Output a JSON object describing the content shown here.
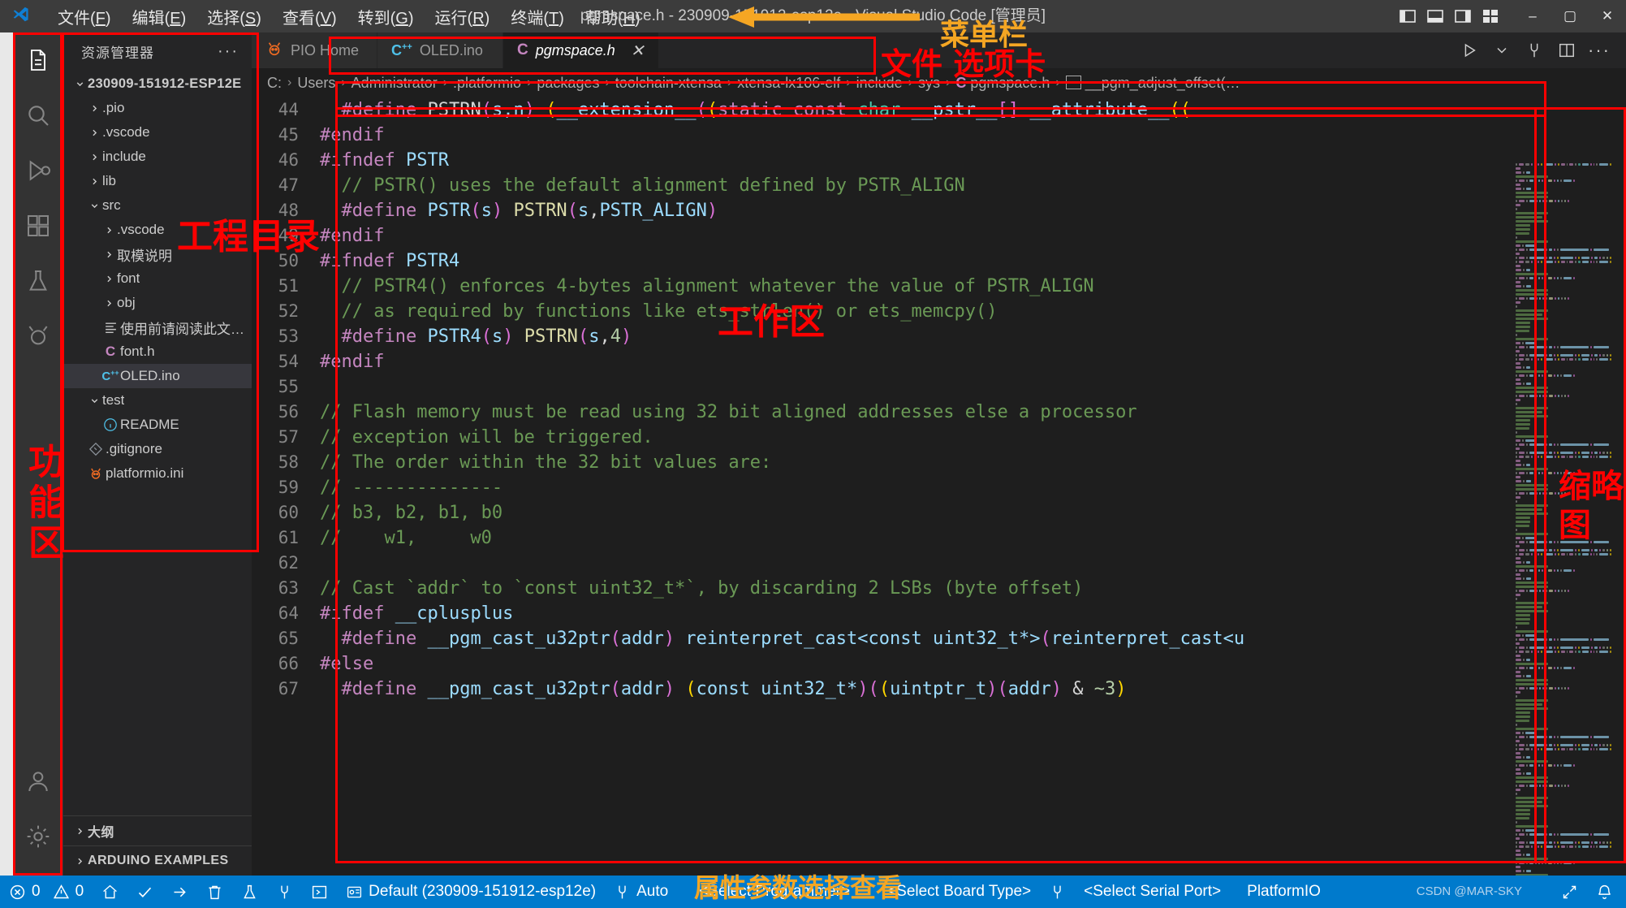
{
  "window": {
    "title": "pgmspace.h - 230909-151912-esp12e - Visual Studio Code [管理员]",
    "minimize": "–",
    "maximize": "▢",
    "close": "✕"
  },
  "menubar": {
    "items": [
      {
        "label": "文件",
        "accel": "F"
      },
      {
        "label": "编辑",
        "accel": "E"
      },
      {
        "label": "选择",
        "accel": "S"
      },
      {
        "label": "查看",
        "accel": "V"
      },
      {
        "label": "转到",
        "accel": "G"
      },
      {
        "label": "运行",
        "accel": "R"
      },
      {
        "label": "终端",
        "accel": "T"
      },
      {
        "label": "帮助",
        "accel": "H"
      }
    ]
  },
  "activitybar": {
    "items": [
      {
        "name": "explorer",
        "icon": "files-icon",
        "active": true
      },
      {
        "name": "search",
        "icon": "search-icon",
        "active": false
      },
      {
        "name": "run-debug",
        "icon": "run-debug-icon",
        "active": false
      },
      {
        "name": "extensions",
        "icon": "extensions-icon",
        "active": false
      },
      {
        "name": "testing",
        "icon": "flask-icon",
        "active": false
      },
      {
        "name": "platformio",
        "icon": "platformio-ant-icon",
        "active": false
      },
      {
        "name": "accounts",
        "icon": "account-icon",
        "active": false
      },
      {
        "name": "settings",
        "icon": "gear-icon",
        "active": false
      }
    ]
  },
  "sidebar": {
    "title": "资源管理器",
    "more": "···",
    "root": "230909-151912-ESP12E",
    "tree": [
      {
        "label": ".pio",
        "indent": 1,
        "type": "folder",
        "expanded": false
      },
      {
        "label": ".vscode",
        "indent": 1,
        "type": "folder",
        "expanded": false
      },
      {
        "label": "include",
        "indent": 1,
        "type": "folder",
        "expanded": false
      },
      {
        "label": "lib",
        "indent": 1,
        "type": "folder",
        "expanded": false
      },
      {
        "label": "src",
        "indent": 1,
        "type": "folder",
        "expanded": true
      },
      {
        "label": ".vscode",
        "indent": 2,
        "type": "folder",
        "expanded": false
      },
      {
        "label": "取模说明",
        "indent": 2,
        "type": "folder",
        "expanded": false
      },
      {
        "label": "font",
        "indent": 2,
        "type": "folder",
        "expanded": false
      },
      {
        "label": "obj",
        "indent": 2,
        "type": "folder",
        "expanded": false
      },
      {
        "label": "使用前请阅读此文档…",
        "indent": 2,
        "type": "file",
        "icon": "text-file-icon"
      },
      {
        "label": "font.h",
        "indent": 2,
        "type": "file",
        "icon": "c-header-icon"
      },
      {
        "label": "OLED.ino",
        "indent": 2,
        "type": "file",
        "icon": "cpp-file-icon",
        "selected": true
      },
      {
        "label": "test",
        "indent": 1,
        "type": "folder",
        "expanded": true
      },
      {
        "label": "README",
        "indent": 2,
        "type": "file",
        "icon": "info-icon"
      },
      {
        "label": ".gitignore",
        "indent": 1,
        "type": "file",
        "icon": "git-icon"
      },
      {
        "label": "platformio.ini",
        "indent": 1,
        "type": "file",
        "icon": "platformio-ant-icon"
      }
    ],
    "sections": [
      {
        "label": "大纲"
      },
      {
        "label": "ARDUINO EXAMPLES"
      }
    ]
  },
  "tabs": [
    {
      "label": "PIO Home",
      "icon": "platformio-ant-icon",
      "active": false,
      "closable": false
    },
    {
      "label": "OLED.ino",
      "icon": "cpp-file-icon",
      "active": false,
      "closable": false
    },
    {
      "label": "pgmspace.h",
      "icon": "c-header-icon",
      "active": true,
      "closable": true,
      "close": "✕"
    }
  ],
  "tab_actions": [
    {
      "name": "run-button",
      "icon": "play-icon"
    },
    {
      "name": "run-dropdown",
      "icon": "chevron-down-icon"
    },
    {
      "name": "serial-monitor-button",
      "icon": "plug-icon"
    },
    {
      "name": "split-editor-button",
      "icon": "split-icon"
    },
    {
      "name": "more-actions-button",
      "icon": "ellipsis-icon"
    }
  ],
  "breadcrumb": {
    "items": [
      "C:",
      "Users",
      "Administrator",
      ".platformio",
      "packages",
      "toolchain-xtensa",
      "xtensa-lx106-elf",
      "include",
      "sys",
      "pgmspace.h",
      "__pgm_adjust_offset(…"
    ],
    "separator": "›"
  },
  "code": {
    "first_line": 44,
    "lines": [
      {
        "n": 44,
        "tokens": [
          {
            "t": "  ",
            "c": "k-txt"
          },
          {
            "t": "#define",
            "c": "k-pre"
          },
          {
            "t": " PSTRN",
            "c": "k-txt"
          },
          {
            "t": "(",
            "c": "k-pr"
          },
          {
            "t": "s,n",
            "c": "k-id"
          },
          {
            "t": ")",
            "c": "k-pr"
          },
          {
            "t": " (",
            "c": "k-pl"
          },
          {
            "t": "__extension__",
            "c": "k-id"
          },
          {
            "t": "(",
            "c": "k-pr"
          },
          {
            "t": "(",
            "c": "k-pl"
          },
          {
            "t": "static",
            "c": "k-pre"
          },
          {
            "t": " ",
            "c": "k-txt"
          },
          {
            "t": "const",
            "c": "k-pre"
          },
          {
            "t": " ",
            "c": "k-txt"
          },
          {
            "t": "char",
            "c": "k-type"
          },
          {
            "t": " __pstr__",
            "c": "k-id"
          },
          {
            "t": "[",
            "c": "k-pr"
          },
          {
            "t": "]",
            "c": "k-pr"
          },
          {
            "t": " ",
            "c": "k-txt"
          },
          {
            "t": "__attribute__",
            "c": "k-id"
          },
          {
            "t": "((",
            "c": "k-pl"
          }
        ]
      },
      {
        "n": 45,
        "tokens": [
          {
            "t": "#endif",
            "c": "k-pre"
          }
        ]
      },
      {
        "n": 46,
        "tokens": [
          {
            "t": "#ifndef",
            "c": "k-pre"
          },
          {
            "t": " ",
            "c": "k-txt"
          },
          {
            "t": "PSTR",
            "c": "k-id"
          }
        ]
      },
      {
        "n": 47,
        "tokens": [
          {
            "t": "  // PSTR() uses the default alignment defined by PSTR_ALIGN",
            "c": "k-cmt"
          }
        ]
      },
      {
        "n": 48,
        "tokens": [
          {
            "t": "  ",
            "c": "k-txt"
          },
          {
            "t": "#define",
            "c": "k-pre"
          },
          {
            "t": " ",
            "c": "k-txt"
          },
          {
            "t": "PSTR",
            "c": "k-id"
          },
          {
            "t": "(",
            "c": "k-pr"
          },
          {
            "t": "s",
            "c": "k-id"
          },
          {
            "t": ")",
            "c": "k-pr"
          },
          {
            "t": " ",
            "c": "k-txt"
          },
          {
            "t": "PSTRN",
            "c": "k-fn"
          },
          {
            "t": "(",
            "c": "k-pr"
          },
          {
            "t": "s",
            "c": "k-id"
          },
          {
            "t": ",",
            "c": "k-txt"
          },
          {
            "t": "PSTR_ALIGN",
            "c": "k-id"
          },
          {
            "t": ")",
            "c": "k-pr"
          }
        ]
      },
      {
        "n": 49,
        "tokens": [
          {
            "t": "#endif",
            "c": "k-pre"
          }
        ]
      },
      {
        "n": 50,
        "tokens": [
          {
            "t": "#ifndef",
            "c": "k-pre"
          },
          {
            "t": " ",
            "c": "k-txt"
          },
          {
            "t": "PSTR4",
            "c": "k-id"
          }
        ]
      },
      {
        "n": 51,
        "tokens": [
          {
            "t": "  // PSTR4() enforces 4-bytes alignment whatever the value of PSTR_ALIGN",
            "c": "k-cmt"
          }
        ]
      },
      {
        "n": 52,
        "tokens": [
          {
            "t": "  // as required by functions like ets_strlen() or ets_memcpy()",
            "c": "k-cmt"
          }
        ]
      },
      {
        "n": 53,
        "tokens": [
          {
            "t": "  ",
            "c": "k-txt"
          },
          {
            "t": "#define",
            "c": "k-pre"
          },
          {
            "t": " ",
            "c": "k-txt"
          },
          {
            "t": "PSTR4",
            "c": "k-id"
          },
          {
            "t": "(",
            "c": "k-pr"
          },
          {
            "t": "s",
            "c": "k-id"
          },
          {
            "t": ")",
            "c": "k-pr"
          },
          {
            "t": " ",
            "c": "k-txt"
          },
          {
            "t": "PSTRN",
            "c": "k-fn"
          },
          {
            "t": "(",
            "c": "k-pr"
          },
          {
            "t": "s",
            "c": "k-id"
          },
          {
            "t": ",",
            "c": "k-txt"
          },
          {
            "t": "4",
            "c": "k-num"
          },
          {
            "t": ")",
            "c": "k-pr"
          }
        ]
      },
      {
        "n": 54,
        "tokens": [
          {
            "t": "#endif",
            "c": "k-pre"
          }
        ]
      },
      {
        "n": 55,
        "tokens": []
      },
      {
        "n": 56,
        "tokens": [
          {
            "t": "// Flash memory must be read using 32 bit aligned addresses else a processor",
            "c": "k-cmt"
          }
        ]
      },
      {
        "n": 57,
        "tokens": [
          {
            "t": "// exception will be triggered.",
            "c": "k-cmt"
          }
        ]
      },
      {
        "n": 58,
        "tokens": [
          {
            "t": "// The order within the 32 bit values are:",
            "c": "k-cmt"
          }
        ]
      },
      {
        "n": 59,
        "tokens": [
          {
            "t": "// --------------",
            "c": "k-cmt"
          }
        ]
      },
      {
        "n": 60,
        "tokens": [
          {
            "t": "// b3, b2, b1, b0",
            "c": "k-cmt"
          }
        ]
      },
      {
        "n": 61,
        "tokens": [
          {
            "t": "//    w1,     w0",
            "c": "k-cmt"
          }
        ]
      },
      {
        "n": 62,
        "tokens": []
      },
      {
        "n": 63,
        "tokens": [
          {
            "t": "// Cast `addr` to `const uint32_t*`, by discarding 2 LSBs (byte offset)",
            "c": "k-cmt"
          }
        ]
      },
      {
        "n": 64,
        "tokens": [
          {
            "t": "#ifdef",
            "c": "k-pre"
          },
          {
            "t": " ",
            "c": "k-txt"
          },
          {
            "t": "__cplusplus",
            "c": "k-id"
          }
        ]
      },
      {
        "n": 65,
        "tokens": [
          {
            "t": "  ",
            "c": "k-txt"
          },
          {
            "t": "#define",
            "c": "k-pre"
          },
          {
            "t": " ",
            "c": "k-txt"
          },
          {
            "t": "__pgm_cast_u32ptr",
            "c": "k-id"
          },
          {
            "t": "(",
            "c": "k-pr"
          },
          {
            "t": "addr",
            "c": "k-id"
          },
          {
            "t": ")",
            "c": "k-pr"
          },
          {
            "t": " ",
            "c": "k-txt"
          },
          {
            "t": "reinterpret_cast<const uint32_t*>",
            "c": "k-id"
          },
          {
            "t": "(",
            "c": "k-pr"
          },
          {
            "t": "reinterpret_cast<u",
            "c": "k-id"
          }
        ]
      },
      {
        "n": 66,
        "tokens": [
          {
            "t": "#else",
            "c": "k-pre"
          }
        ]
      },
      {
        "n": 67,
        "tokens": [
          {
            "t": "  ",
            "c": "k-txt"
          },
          {
            "t": "#define",
            "c": "k-pre"
          },
          {
            "t": " ",
            "c": "k-txt"
          },
          {
            "t": "__pgm_cast_u32ptr",
            "c": "k-id"
          },
          {
            "t": "(",
            "c": "k-pr"
          },
          {
            "t": "addr",
            "c": "k-id"
          },
          {
            "t": ")",
            "c": "k-pr"
          },
          {
            "t": " (",
            "c": "k-pl"
          },
          {
            "t": "const uint32_t*",
            "c": "k-id"
          },
          {
            "t": ")(",
            "c": "k-pr"
          },
          {
            "t": "(",
            "c": "k-pl"
          },
          {
            "t": "uintptr_t",
            "c": "k-id"
          },
          {
            "t": ")(",
            "c": "k-pr"
          },
          {
            "t": "addr",
            "c": "k-id"
          },
          {
            "t": ")",
            "c": "k-pr"
          },
          {
            "t": " & ",
            "c": "k-txt"
          },
          {
            "t": "~3",
            "c": "k-num"
          },
          {
            "t": ")",
            "c": "k-pl"
          }
        ]
      }
    ]
  },
  "statusbar": {
    "left": [
      {
        "name": "problems",
        "icon": "error-icon",
        "label": "0"
      },
      {
        "name": "warnings",
        "icon": "warning-icon",
        "label": "0"
      },
      {
        "name": "pio-home",
        "icon": "home-icon",
        "label": ""
      },
      {
        "name": "pio-build",
        "icon": "check-icon",
        "label": ""
      },
      {
        "name": "pio-upload",
        "icon": "arrow-right-icon",
        "label": ""
      },
      {
        "name": "pio-clean",
        "icon": "trash-icon",
        "label": ""
      },
      {
        "name": "pio-test",
        "icon": "flask-icon",
        "label": ""
      },
      {
        "name": "pio-serial-monitor",
        "icon": "plug-icon",
        "label": ""
      },
      {
        "name": "pio-terminal",
        "icon": "terminal-icon",
        "label": ""
      },
      {
        "name": "pio-project-env",
        "icon": "folder-env-icon",
        "label": "Default (230909-151912-esp12e)"
      },
      {
        "name": "pio-port-auto",
        "icon": "plug-icon",
        "label": "Auto"
      }
    ],
    "right": [
      {
        "name": "select-programmer",
        "icon": "",
        "label": "<Select Programmer>"
      },
      {
        "name": "select-board-type",
        "icon": "",
        "label": "<Select Board Type>"
      },
      {
        "name": "serial-port-icon",
        "icon": "plug-icon",
        "label": ""
      },
      {
        "name": "select-serial-port",
        "icon": "",
        "label": "<Select Serial Port>"
      },
      {
        "name": "platformio-label",
        "icon": "",
        "label": "PlatformIO"
      },
      {
        "name": "remote-indicator",
        "icon": "remote-icon",
        "label": ""
      },
      {
        "name": "bell",
        "icon": "bell-icon",
        "label": ""
      }
    ],
    "watermark": "CSDN @MAR-SKY"
  },
  "annotations": [
    {
      "name": "menubar-annotation",
      "text": "菜单栏",
      "color": "#f5a623"
    },
    {
      "name": "tabs-annotation",
      "text": "文件 选项卡",
      "color": "#ff0000"
    },
    {
      "name": "project-tree-annotation",
      "text": "工程目录",
      "color": "#ff0000"
    },
    {
      "name": "workspace-annotation",
      "text": "工作区",
      "color": "#ff0000"
    },
    {
      "name": "activity-annotation",
      "text": "功能区",
      "color": "#ff0000"
    },
    {
      "name": "minimap-annotation",
      "text": "缩略图",
      "color": "#ff0000"
    },
    {
      "name": "properties-annotation",
      "text": "属性参数选择查看",
      "color": "#f5a623"
    }
  ]
}
